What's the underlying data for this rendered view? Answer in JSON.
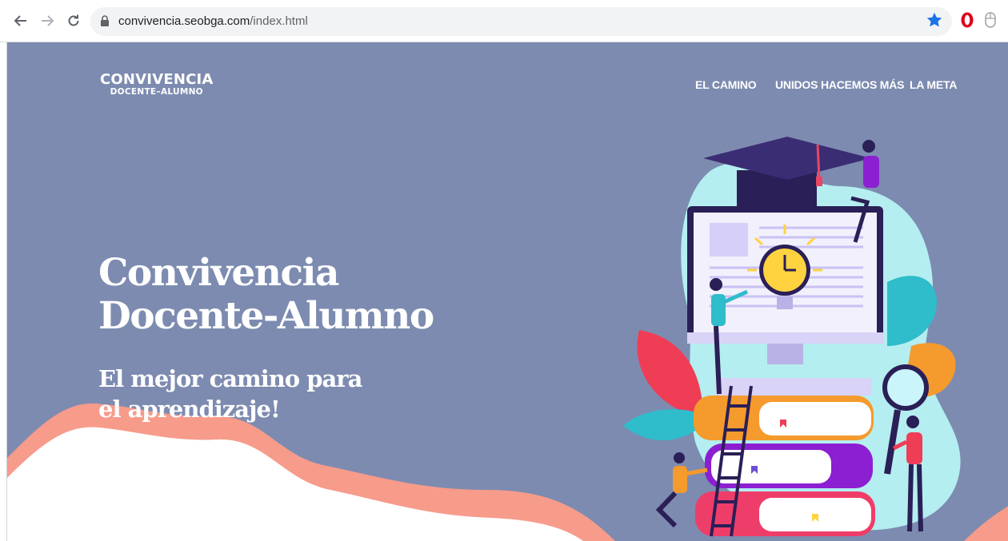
{
  "browser": {
    "url_domain": "convivencia.seobga.com",
    "url_path": "/index.html"
  },
  "site": {
    "logo_main": "CONVIVENCIA",
    "logo_sub": "DOCENTE–ALUMNO",
    "nav": [
      {
        "label": "EL CAMINO"
      },
      {
        "label": "UNIDOS HACEMOS MÁS"
      },
      {
        "label": "LA META"
      }
    ]
  },
  "hero": {
    "title_line1": "Convivencia",
    "title_line2": "Docente-Alumno",
    "subtitle_line1": "El mejor camino para",
    "subtitle_line2": "el aprendizaje!"
  },
  "colors": {
    "page_bg": "#7d8bb0",
    "wave_salmon": "#f79b8b",
    "accent_star": "#1a73e8",
    "opera_red": "#e0001b"
  },
  "icons": [
    "back-arrow-icon",
    "forward-arrow-icon",
    "reload-icon",
    "lock-icon",
    "bookmark-star-icon",
    "opera-icon",
    "extension-icon"
  ]
}
